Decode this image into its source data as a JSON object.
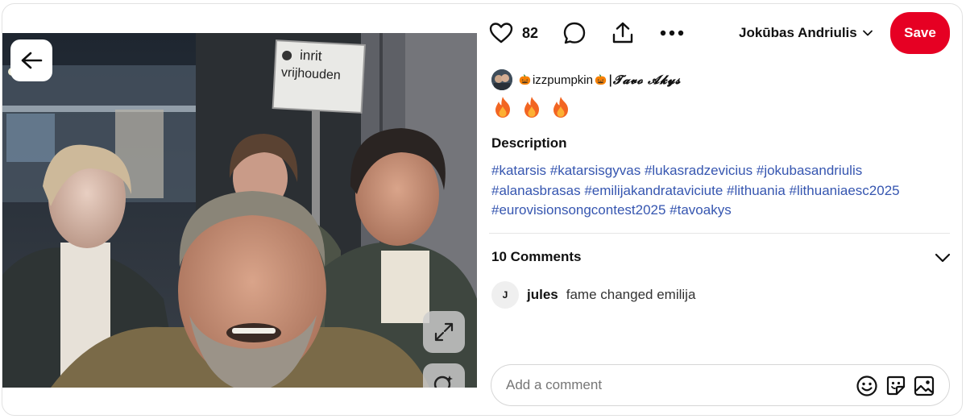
{
  "actions": {
    "like_count": "82"
  },
  "board": {
    "name": "Jokūbas Andriulis"
  },
  "save_label": "Save",
  "creator": {
    "name_prefix": "izzpumpkin",
    "name_suffix": "|𝓣𝓪𝓿𝓸 𝓐𝓴𝔂𝓼"
  },
  "description": {
    "heading": "Description",
    "tags": [
      "#katarsis",
      "#katarsisgyvas",
      "#lukasradzevicius",
      "#jokubasandriulis",
      "#alanasbrasas",
      "#emilijakandrataviciute",
      "#lithuania",
      "#lithuaniaesc2025",
      "#eurovisionsongcontest2025",
      "#tavoakys"
    ]
  },
  "comments": {
    "heading": "10 Comments",
    "items": [
      {
        "avatar_letter": "J",
        "user": "jules",
        "text": "fame changed emilija"
      }
    ],
    "input_placeholder": "Add a comment"
  },
  "photo": {
    "sign_line1": "inrit",
    "sign_line2": "vrijhouden"
  },
  "colors": {
    "save": "#e60023",
    "hashtag": "#3656b0",
    "flame": "#f26522"
  },
  "icons": {
    "back": "arrow-left-icon",
    "like": "heart-icon",
    "comment": "speech-bubble-icon",
    "share": "share-upload-icon",
    "more": "more-dots-icon",
    "board_dropdown": "chevron-down-icon",
    "expand": "expand-icon",
    "visual_search": "lens-search-icon",
    "emoji": "smiley-icon",
    "sticker": "sticker-icon",
    "image": "image-icon",
    "flames": "fire-emoji"
  }
}
